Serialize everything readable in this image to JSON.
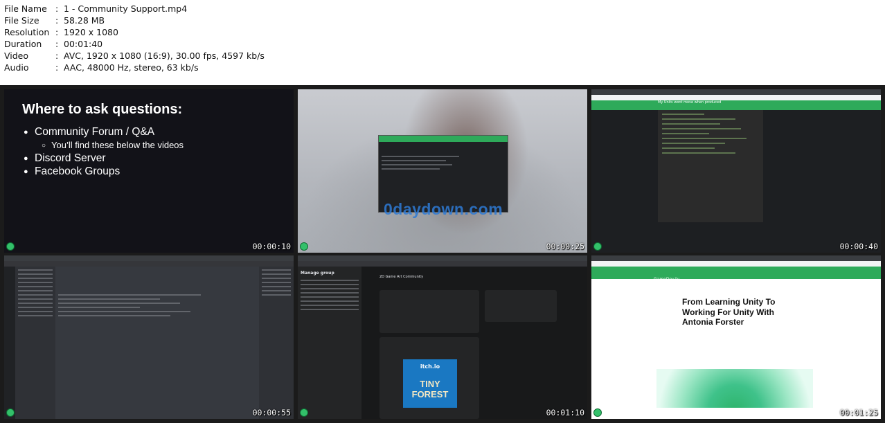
{
  "media_info": [
    {
      "key": "File Name",
      "sep": ":",
      "value": "1 - Community Support.mp4"
    },
    {
      "key": "File Size",
      "sep": ":",
      "value": "58.28 MB"
    },
    {
      "key": "Resolution",
      "sep": ":",
      "value": "1920 x 1080"
    },
    {
      "key": "Duration",
      "sep": ":",
      "value": "00:01:40"
    },
    {
      "key": "Video",
      "sep": ":",
      "value": "AVC, 1920 x 1080 (16:9), 30.00 fps, 4597 kb/s"
    },
    {
      "key": "Audio",
      "sep": ":",
      "value": "AAC, 48000 Hz, stereo, 63 kb/s"
    }
  ],
  "thumbnails": [
    {
      "timestamp": "00:00:10",
      "slide_title": "Where to ask questions:",
      "bullets": [
        "Community Forum / Q&A",
        "You’ll find these below the videos",
        "Discord Server",
        "Facebook Groups"
      ]
    },
    {
      "timestamp": "00:00:25",
      "watermark": "0daydown.com"
    },
    {
      "timestamp": "00:00:40",
      "post_title": "My Units wont move when produced"
    },
    {
      "timestamp": "00:00:55"
    },
    {
      "timestamp": "00:01:10",
      "manage_group": "Manage group",
      "group_name": "2D Game Art Community",
      "itch_label": "itch.io",
      "game_title": "TINY FOREST"
    },
    {
      "timestamp": "00:01:25",
      "site_logo": "GameDev.tv",
      "article_title": "From Learning Unity To Working For Unity With Antonia Forster"
    }
  ],
  "colors": {
    "accent_green": "#2eaa5a",
    "discord_bg": "#36393f",
    "facebook_bg": "#18191a",
    "watermark_blue": "#2e7bd6"
  }
}
